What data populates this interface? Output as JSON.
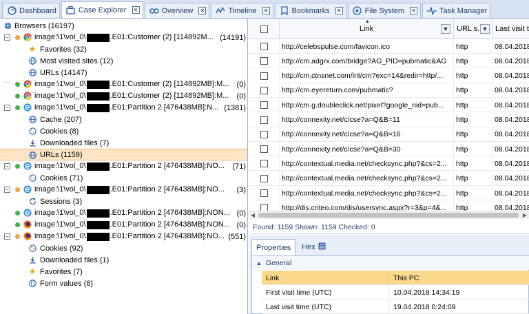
{
  "tabs": [
    {
      "label": "Dashboard",
      "icon": "dashboard-icon",
      "closable": false,
      "active": false
    },
    {
      "label": "Case Explorer",
      "icon": "case-explorer-icon",
      "closable": true,
      "active": true
    },
    {
      "label": "Overview",
      "icon": "overview-icon",
      "closable": true,
      "active": false
    },
    {
      "label": "Timeline",
      "icon": "timeline-icon",
      "closable": true,
      "active": false
    },
    {
      "label": "Bookmarks",
      "icon": "bookmark-icon",
      "closable": true,
      "active": false
    },
    {
      "label": "File System",
      "icon": "file-system-icon",
      "closable": true,
      "active": false
    },
    {
      "label": "Task Manager",
      "icon": "task-manager-icon",
      "closable": false,
      "active": false
    }
  ],
  "tree": {
    "root": {
      "label": "Browsers",
      "count": "(16197)"
    },
    "nodes": [
      {
        "level": 1,
        "expander": "-",
        "dot": "#f2a33a",
        "icon": "chrome-icon",
        "text_before": "image:\\1\\vol_0\\",
        "text_after": ".E01:Customer (2) [114892M...",
        "count": "(14191)"
      },
      {
        "level": 2,
        "icon": "star-icon",
        "label": "Favorites",
        "count": "(32)"
      },
      {
        "level": 2,
        "icon": "globe-icon",
        "label": "Most visited sites",
        "count": "(12)"
      },
      {
        "level": 2,
        "icon": "globe-icon",
        "label": "URLs",
        "count": "(14147)"
      },
      {
        "level": 1,
        "expander": "...",
        "dot": "#3cb44b",
        "icon": "chrome-icon",
        "text_before": "image:\\1\\vol_0\\",
        "text_after": ".E01:Customer (2) [114892MB]:M...",
        "count": "(0)"
      },
      {
        "level": 1,
        "expander": "",
        "dot": "#3cb44b",
        "icon": "chrome-icon",
        "text_before": "image:\\1\\vol_0\\",
        "text_after": ".E01:Customer (2) [114892MB]:M...",
        "count": "(0)"
      },
      {
        "level": 1,
        "expander": "-",
        "dot": "#3cb44b",
        "icon": "edge-icon",
        "text_before": "image:\\1\\vol_0\\",
        "text_after": ".E01:Partition 2 [476438MB]:N...",
        "count": "(1381)"
      },
      {
        "level": 2,
        "icon": "globe-icon",
        "label": "Cache",
        "count": "(207)"
      },
      {
        "level": 2,
        "icon": "cookie-icon",
        "label": "Cookies",
        "count": "(8)"
      },
      {
        "level": 2,
        "icon": "download-icon",
        "label": "Downloaded files",
        "count": "(7)"
      },
      {
        "level": 2,
        "icon": "globe-icon",
        "label": "URLs (1159)",
        "count": "",
        "selected": true
      },
      {
        "level": 1,
        "expander": "-",
        "dot": "#3cb44b",
        "icon": "edge-icon",
        "text_before": "image:\\1\\vol_0\\",
        "text_after": ".E01:Partition 2 [476438MB]:NO...",
        "count": "(71)"
      },
      {
        "level": 2,
        "icon": "cookie-icon",
        "label": "Cookies",
        "count": "(71)"
      },
      {
        "level": 1,
        "expander": "-",
        "dot": "#f2a33a",
        "icon": "edge-icon",
        "text_before": "image:\\1\\vol_0\\",
        "text_after": ".E01:Partition 2 [476438MB]:NO...",
        "count": "(3)"
      },
      {
        "level": 2,
        "icon": "sessions-icon",
        "label": "Sessions",
        "count": "(3)"
      },
      {
        "level": 1,
        "expander": "",
        "dot": "#3cb44b",
        "icon": "edge-icon",
        "text_before": "image:\\1\\vol_0\\",
        "text_after": ".E01:Partition 2 [476438MB]:NON...",
        "count": "(0)"
      },
      {
        "level": 1,
        "expander": "",
        "dot": "#3cb44b",
        "icon": "firefox-icon",
        "text_before": "image:\\1\\vol_0\\",
        "text_after": ".E01:Partition 2 [476438MB]:NON...",
        "count": "(0)"
      },
      {
        "level": 1,
        "expander": "-",
        "dot": "#f2a33a",
        "icon": "firefox-icon",
        "text_before": "image:\\1\\vol_0\\",
        "text_after": ".E01:Partition 2 [476438MB]:NO...",
        "count": "(551)"
      },
      {
        "level": 2,
        "icon": "cookie-icon",
        "label": "Cookies",
        "count": "(92)"
      },
      {
        "level": 2,
        "icon": "download-icon",
        "label": "Downloaded files",
        "count": "(1)"
      },
      {
        "level": 2,
        "icon": "star-icon",
        "label": "Favorites",
        "count": "(7)"
      },
      {
        "level": 2,
        "icon": "form-icon",
        "label": "Form values",
        "count": "(8)"
      }
    ]
  },
  "grid": {
    "columns": [
      "Link",
      "URL s...",
      "Last visit t"
    ],
    "sort_indicator": "▲",
    "rows": [
      {
        "link": "http://celebspulse.com/favicon.ico",
        "scheme": "http",
        "last": "08.04.2018"
      },
      {
        "link": "http://cm.adgrx.com/bridge?AG_PID=pubmatic&AG",
        "scheme": "http",
        "last": "08.04.2018"
      },
      {
        "link": "http://cm.ctnsnet.com/int/cm?exc=14&redir=http/...",
        "scheme": "http",
        "last": "08.04.2018"
      },
      {
        "link": "http://cm.eyereturn.com/pubmatic?",
        "scheme": "http",
        "last": "08.04.2018"
      },
      {
        "link": "http://cm.g.doubleclick.net/pixel?google_nid=pub...",
        "scheme": "http",
        "last": "08.04.2018"
      },
      {
        "link": "http://connexity.net/c/cse?a=Q&B=11",
        "scheme": "http",
        "last": "08.04.2018"
      },
      {
        "link": "http://connexity.net/c/cse?a=Q&B=16",
        "scheme": "http",
        "last": "08.04.2018"
      },
      {
        "link": "http://connexity.net/c/cse?a=Q&B=30",
        "scheme": "http",
        "last": "08.04.2018"
      },
      {
        "link": "http://contextual.media.net/checksync.php?&cs=2...",
        "scheme": "http",
        "last": "08.04.2018"
      },
      {
        "link": "http://contextual.media.net/checksync.php?&cs=2...",
        "scheme": "http",
        "last": "08.04.2018"
      },
      {
        "link": "http://contextual.media.net/checksync.php?&cs=2...",
        "scheme": "http",
        "last": "08.04.2018"
      },
      {
        "link": "http://dis.criteo.com/dis/usersync.aspx?r=3&p=4&...",
        "scheme": "http",
        "last": "08.04.2018"
      }
    ]
  },
  "status": "Found: 1159  Shown: 1159  Checked: 0",
  "properties": {
    "tabs": [
      "Properties",
      "Hex"
    ],
    "group": "General",
    "rows": [
      {
        "key": "Link",
        "value": "This PC",
        "highlight": true
      },
      {
        "key": "First visit time (UTC)",
        "value": "10.04.2018 14:34:19",
        "highlight": false
      },
      {
        "key": "Last visit time (UTC)",
        "value": "19.04.2018 0:24:09",
        "highlight": false
      }
    ]
  }
}
